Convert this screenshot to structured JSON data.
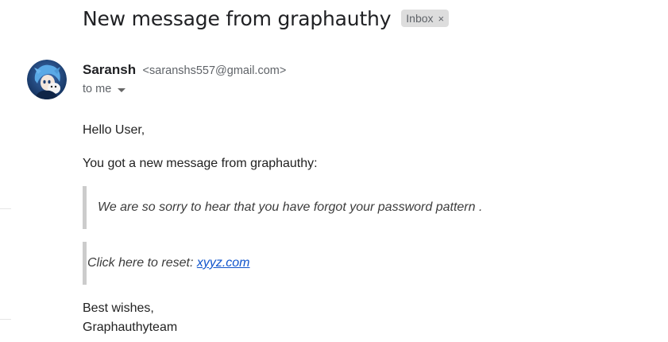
{
  "email": {
    "subject": "New message from graphauthy",
    "label": "Inbox",
    "label_remove_glyph": "×",
    "sender": {
      "name": "Saransh",
      "email": "<saranshs557@gmail.com>",
      "avatar_icon": "user-avatar-icon"
    },
    "recipient": "to me",
    "body": {
      "greeting": "Hello User,",
      "intro": "You got a new message from graphauthy:",
      "quote_message": "We are so sorry to hear that you have forgot your password pattern .",
      "reset_prefix": "Click here to reset: ",
      "reset_link_text": "xyyz.com",
      "closing": "Best wishes,",
      "signature": "Graphauthyteam"
    }
  },
  "colors": {
    "link": "#1155cc",
    "label_chip_bg": "#dddddd",
    "quote_border": "#cccccc",
    "secondary_text": "#5f6368"
  }
}
